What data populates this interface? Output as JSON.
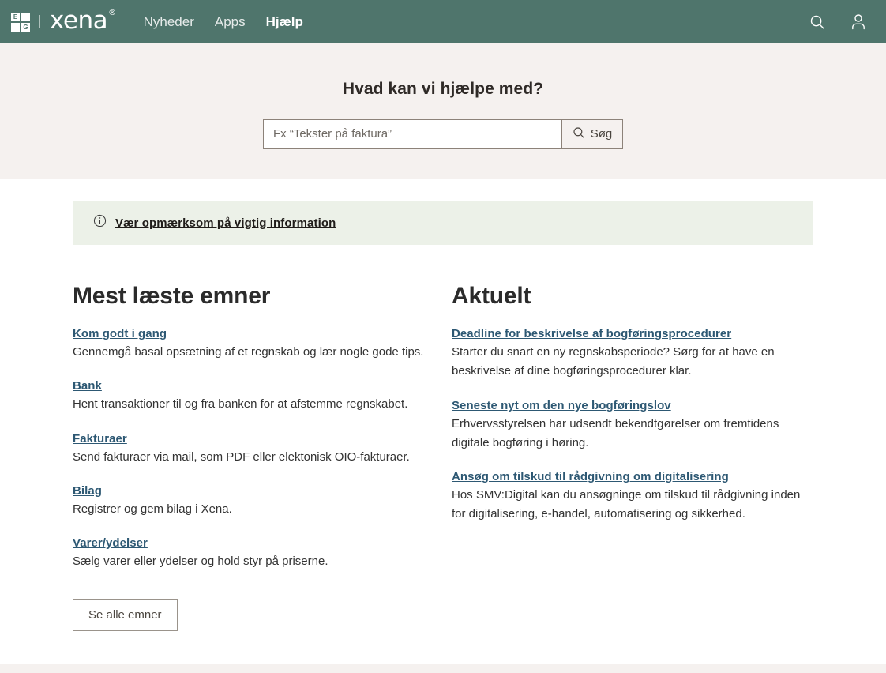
{
  "theme": {
    "header_green": "#4F756C",
    "hero_beige": "#F5F1EF",
    "notice_green": "#ECF1E8",
    "link_blue": "#2D5873",
    "body_text": "#333333"
  },
  "header": {
    "logo": {
      "eg_letters": [
        "E",
        "",
        "",
        "G"
      ],
      "wordmark": "xena",
      "registered_mark": "®"
    },
    "nav": [
      {
        "label": "Nyheder",
        "active": false
      },
      {
        "label": "Apps",
        "active": false
      },
      {
        "label": "Hjælp",
        "active": true
      }
    ],
    "actions": [
      {
        "name": "search-icon",
        "label": "Søg"
      },
      {
        "name": "user-icon",
        "label": "Bruger"
      }
    ]
  },
  "hero": {
    "title": "Hvad kan vi hjælpe med?",
    "search": {
      "value": "",
      "placeholder": "Fx “Tekster på faktura”",
      "button_label": "Søg",
      "button_icon": "search-icon"
    }
  },
  "notice": {
    "icon": "info-circle-icon",
    "link_text": "Vær opmærksom på vigtig information"
  },
  "topics": {
    "title": "Mest læste emner",
    "items": [
      {
        "link": "Kom godt i gang",
        "desc": "Gennemgå basal opsætning af et regnskab og lær nogle gode tips."
      },
      {
        "link": "Bank",
        "desc": "Hent transaktioner til og fra banken for at afstemme regnskabet."
      },
      {
        "link": "Fakturaer",
        "desc": "Send fakturaer via mail, som PDF eller elektonisk OIO-fakturaer."
      },
      {
        "link": "Bilag",
        "desc": "Registrer og gem bilag i Xena."
      },
      {
        "link": "Varer/ydelser",
        "desc": "Sælg varer eller ydelser og hold styr på priserne."
      }
    ],
    "all_button_label": "Se alle emner"
  },
  "news": {
    "title": "Aktuelt",
    "items": [
      {
        "link": "Deadline for beskrivelse af bogføringsprocedurer",
        "desc": "Starter du snart en ny regnskabsperiode? Sørg for at have en beskrivelse af dine bogføringsprocedurer klar."
      },
      {
        "link": "Seneste nyt om den nye bogføringslov",
        "desc": "Erhvervsstyrelsen har udsendt bekendtgørelser om fremtidens digitale bogføring i høring."
      },
      {
        "link": "Ansøg om tilskud til rådgivning om digitalisering",
        "desc": "Hos SMV:Digital kan du ansøgninge om tilskud til rådgivning inden for digitalisering, e-handel, automatisering og sikkerhed."
      }
    ]
  }
}
